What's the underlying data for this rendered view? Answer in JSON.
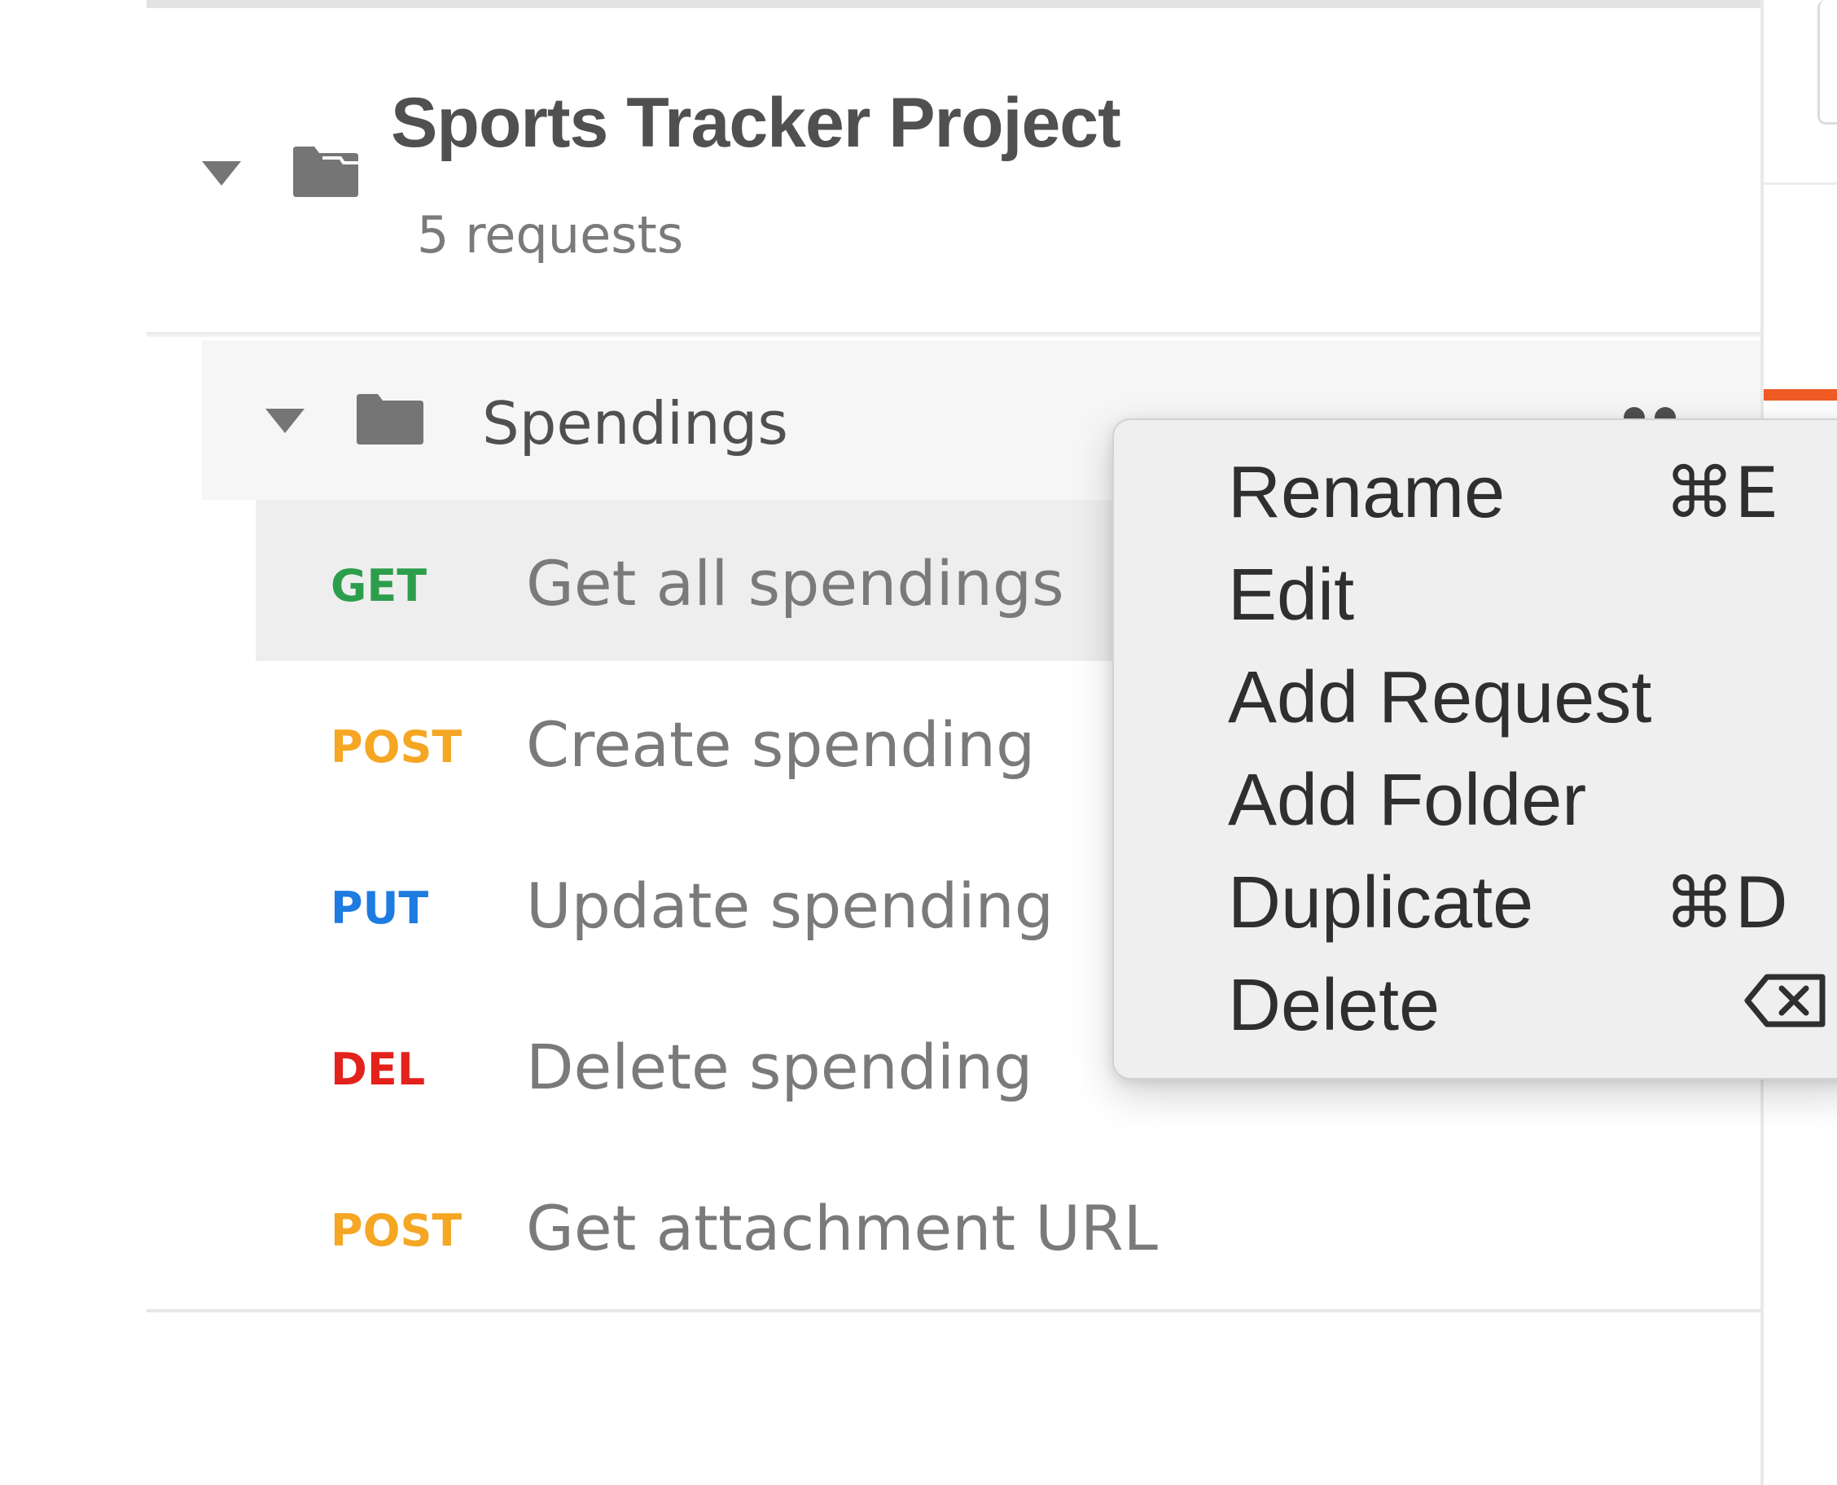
{
  "collection": {
    "title": "Sports Tracker Project",
    "request_count": "5 requests"
  },
  "folder": {
    "name": "Spendings"
  },
  "requests": [
    {
      "method": "GET",
      "name": "Get all spendings",
      "color": "#2c9e4b"
    },
    {
      "method": "POST",
      "name": "Create spending",
      "color": "#f5a623"
    },
    {
      "method": "PUT",
      "name": "Update spending",
      "color": "#1e7be0"
    },
    {
      "method": "DEL",
      "name": "Delete spending",
      "color": "#e3221c"
    },
    {
      "method": "POST",
      "name": "Get attachment URL",
      "color": "#f5a623"
    }
  ],
  "context_menu": {
    "items": [
      {
        "label": "Rename",
        "shortcut": "⌘E"
      },
      {
        "label": "Edit",
        "shortcut": ""
      },
      {
        "label": "Add Request",
        "shortcut": ""
      },
      {
        "label": "Add Folder",
        "shortcut": ""
      },
      {
        "label": "Duplicate",
        "shortcut": "⌘D"
      },
      {
        "label": "Delete",
        "shortcut": ""
      }
    ]
  },
  "colors": {
    "accent": "#ef5b25",
    "get": "#2c9e4b",
    "post": "#f5a623",
    "put": "#1e7be0",
    "del": "#e3221c"
  }
}
